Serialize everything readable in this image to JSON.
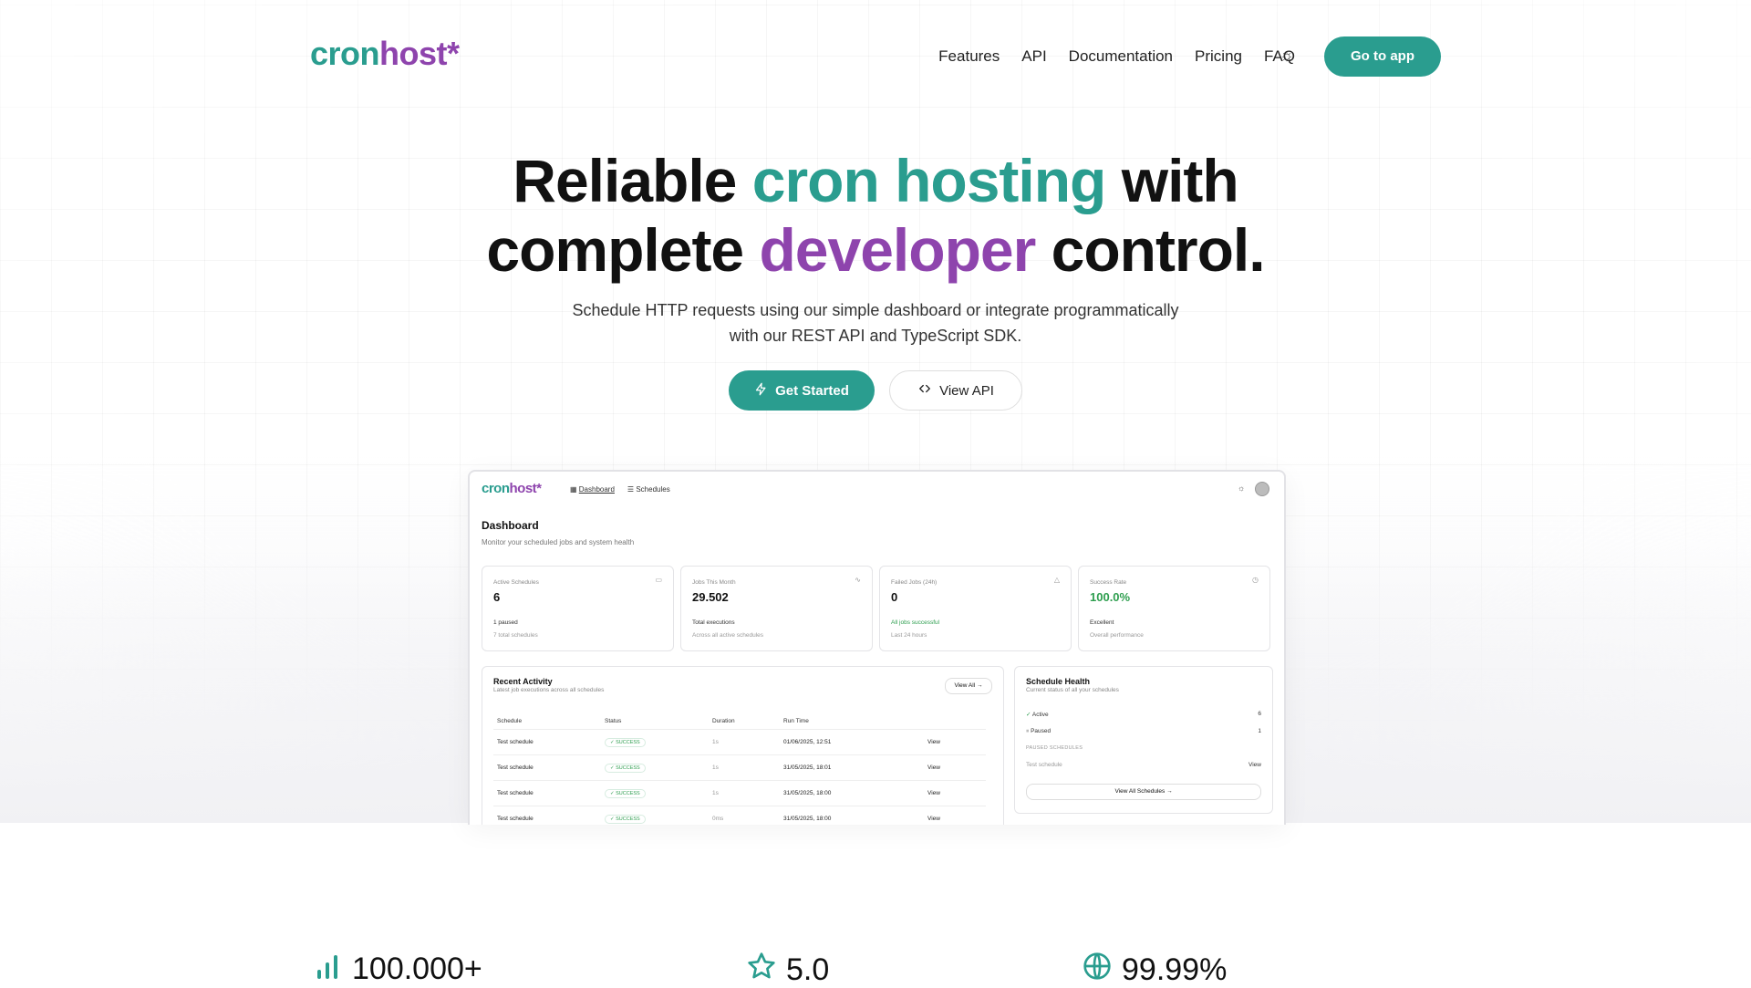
{
  "header": {
    "logo_a": "cron",
    "logo_b": "host*",
    "nav": [
      "Features",
      "API",
      "Documentation",
      "Pricing",
      "FAQ"
    ],
    "theme_icon": "sun-icon",
    "cta": "Go to app"
  },
  "hero": {
    "title_1": "Reliable ",
    "title_2": "cron hosting",
    "title_3": " with",
    "title_4": "complete ",
    "title_5": "developer",
    "title_6": " control.",
    "subtitle_1": "Schedule HTTP requests using our simple dashboard or integrate programmatically",
    "subtitle_2": "with our REST API and TypeScript SDK.",
    "primary_btn": "Get Started",
    "secondary_btn": "View API"
  },
  "preview": {
    "logo_a": "cron",
    "logo_b": "host*",
    "nav_dashboard": "Dashboard",
    "nav_schedules": "Schedules",
    "title": "Dashboard",
    "subtitle": "Monitor your scheduled jobs and system health",
    "cards": [
      {
        "label": "Active Schedules",
        "value": "6",
        "line1": "1 paused",
        "line2": "7 total schedules",
        "icon": "calendar-icon"
      },
      {
        "label": "Jobs This Month",
        "value": "29.502",
        "line1": "Total executions",
        "line2": "Across all active schedules",
        "icon": "activity-icon"
      },
      {
        "label": "Failed Jobs (24h)",
        "value": "0",
        "line1": "All jobs successful",
        "line2": "Last 24 hours",
        "icon": "alert-icon"
      },
      {
        "label": "Success Rate",
        "value": "100.0%",
        "line1": "Excellent",
        "line2": "Overall performance",
        "icon": "clock-icon"
      }
    ],
    "recent": {
      "title": "Recent Activity",
      "subtitle": "Latest job executions across all schedules",
      "view_all": "View All",
      "columns": [
        "Schedule",
        "Status",
        "Duration",
        "Run Time",
        ""
      ],
      "rows": [
        {
          "schedule": "Test schedule",
          "status": "SUCCESS",
          "duration": "1s",
          "run_time": "01/06/2025, 12:51",
          "action": "View"
        },
        {
          "schedule": "Test schedule",
          "status": "SUCCESS",
          "duration": "1s",
          "run_time": "31/05/2025, 18:01",
          "action": "View"
        },
        {
          "schedule": "Test schedule",
          "status": "SUCCESS",
          "duration": "1s",
          "run_time": "31/05/2025, 18:00",
          "action": "View"
        },
        {
          "schedule": "Test schedule",
          "status": "SUCCESS",
          "duration": "0ms",
          "run_time": "31/05/2025, 18:00",
          "action": "View"
        }
      ]
    },
    "health": {
      "title": "Schedule Health",
      "subtitle": "Current status of all your schedules",
      "active_label": "Active",
      "active_count": "6",
      "paused_label": "Paused",
      "paused_count": "1",
      "paused_heading": "PAUSED SCHEDULES",
      "paused_item": "Test schedule",
      "paused_action": "View",
      "view_all": "View All Schedules"
    }
  },
  "stats": [
    {
      "icon": "bar-chart-icon",
      "value": "100.000+"
    },
    {
      "icon": "star-icon",
      "value": "5.0"
    },
    {
      "icon": "globe-icon",
      "value": "99.99%"
    }
  ],
  "colors": {
    "teal": "#2a9d8f",
    "purple": "#8e44ad",
    "success": "#2e9e4f"
  }
}
